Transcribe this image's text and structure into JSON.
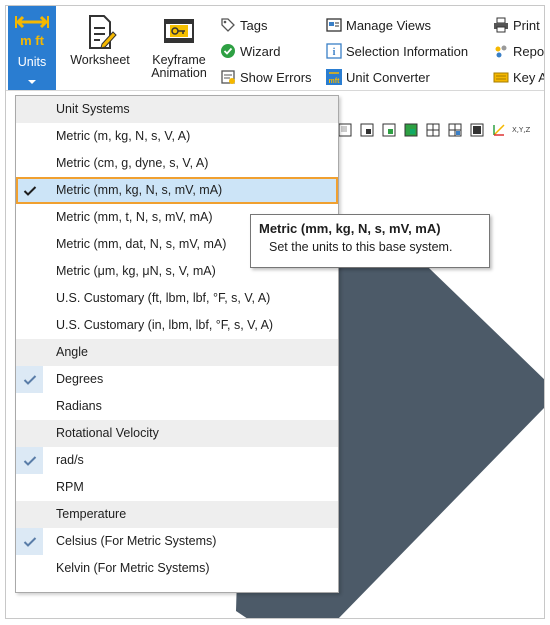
{
  "ribbon": {
    "units_label": "Units",
    "units_icon_text": "m ft",
    "worksheet_label": "Worksheet",
    "keyframe_line1": "Keyframe",
    "keyframe_line2": "Animation",
    "col1": [
      "Tags",
      "Wizard",
      "Show Errors"
    ],
    "col2": [
      "Manage Views",
      "Selection Information",
      "Unit Converter"
    ],
    "col3": [
      "Print",
      "Repo",
      "Key A"
    ]
  },
  "viewport": {
    "axis_label": "X,Y,Z",
    "shape_color": "#4c5a68"
  },
  "menu": {
    "sections": [
      {
        "header": "Unit Systems",
        "items": [
          {
            "label": "Metric (m, kg, N, s, V, A)",
            "checked": false
          },
          {
            "label": "Metric (cm, g, dyne, s, V, A)",
            "checked": false
          },
          {
            "label": "Metric (mm, kg, N, s, mV, mA)",
            "checked": true,
            "selected": true
          },
          {
            "label": "Metric (mm, t, N, s, mV, mA)",
            "checked": false
          },
          {
            "label": "Metric (mm, dat, N, s, mV, mA)",
            "checked": false
          },
          {
            "label": "Metric (μm, kg, μN, s, V, mA)",
            "checked": false
          },
          {
            "label": "U.S. Customary (ft, lbm, lbf, °F, s, V, A)",
            "checked": false
          },
          {
            "label": "U.S. Customary (in, lbm, lbf, °F, s, V, A)",
            "checked": false
          }
        ]
      },
      {
        "header": "Angle",
        "items": [
          {
            "label": "Degrees",
            "checked": true
          },
          {
            "label": "Radians",
            "checked": false
          }
        ]
      },
      {
        "header": "Rotational Velocity",
        "items": [
          {
            "label": "rad/s",
            "checked": true
          },
          {
            "label": "RPM",
            "checked": false
          }
        ]
      },
      {
        "header": "Temperature",
        "items": [
          {
            "label": "Celsius (For Metric Systems)",
            "checked": true
          },
          {
            "label": "Kelvin (For Metric Systems)",
            "checked": false
          }
        ]
      }
    ]
  },
  "tooltip": {
    "title": "Metric (mm, kg, N, s, mV, mA)",
    "description": "Set the units to this base system."
  },
  "colors": {
    "accent": "#2a7dd1",
    "selection_fill": "#cce4f7",
    "selection_border": "#f0a030",
    "header_bg": "#eeeeee"
  }
}
